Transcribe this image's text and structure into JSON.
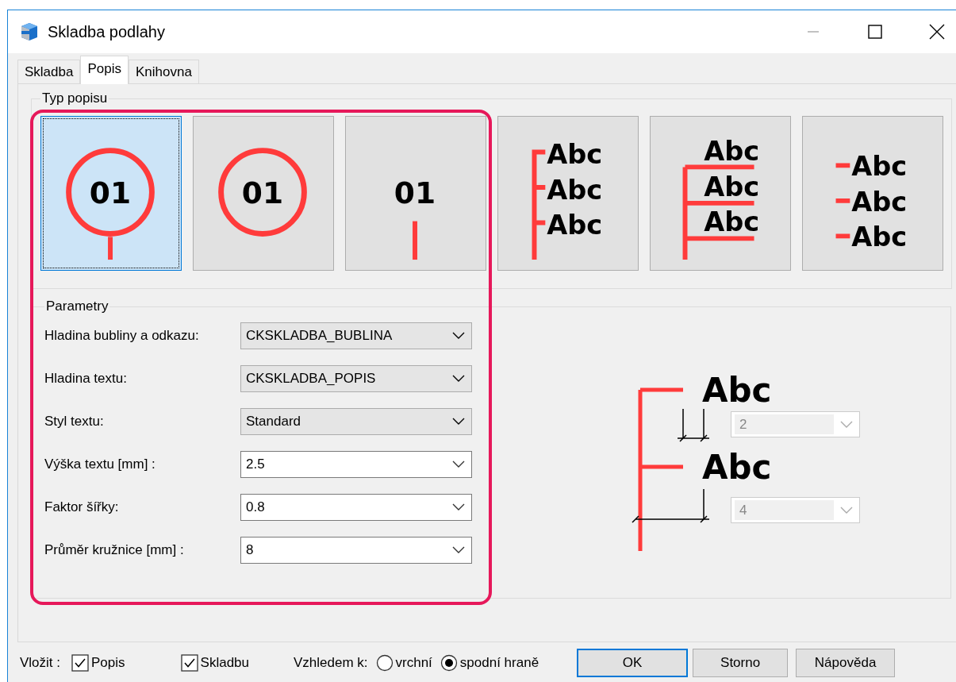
{
  "window": {
    "title": "Skladba podlahy"
  },
  "tabs": [
    {
      "label": "Skladba",
      "selected": false
    },
    {
      "label": "Popis",
      "selected": true
    },
    {
      "label": "Knihovna",
      "selected": false
    }
  ],
  "type_group": {
    "title": "Typ popisu",
    "tiles": [
      {
        "kind": "bubble-stem",
        "labels": [
          "01"
        ],
        "selected": true
      },
      {
        "kind": "bubble",
        "labels": [
          "01"
        ],
        "selected": false
      },
      {
        "kind": "stem",
        "labels": [
          "01"
        ],
        "selected": false
      },
      {
        "kind": "side-ticks",
        "labels": [
          "Abc",
          "Abc",
          "Abc"
        ],
        "selected": false
      },
      {
        "kind": "underlines",
        "labels": [
          "Abc",
          "Abc",
          "Abc"
        ],
        "selected": false
      },
      {
        "kind": "dashes",
        "labels": [
          "Abc",
          "Abc",
          "Abc"
        ],
        "selected": false
      }
    ]
  },
  "parameters": {
    "title": "Parametry",
    "fields": [
      {
        "label": "Hladina bubliny a odkazu:",
        "value": "CKSKLADBA_BUBLINA",
        "kind": "dropdown"
      },
      {
        "label": "Hladina textu:",
        "value": "CKSKLADBA_POPIS",
        "kind": "dropdown"
      },
      {
        "label": "Styl textu:",
        "value": "Standard",
        "kind": "dropdown"
      },
      {
        "label": "Výška textu [mm] :",
        "value": "2.5",
        "kind": "combo"
      },
      {
        "label": "Faktor šířky:",
        "value": "0.8",
        "kind": "combo"
      },
      {
        "label": "Průměr kružnice [mm] :",
        "value": "8",
        "kind": "combo"
      }
    ],
    "diagram": {
      "labels": [
        "Abc",
        "Abc"
      ],
      "fields": [
        {
          "value": "2",
          "disabled": true
        },
        {
          "value": "4",
          "disabled": true
        }
      ]
    }
  },
  "insert": {
    "label": "Vložit :",
    "options": [
      {
        "label": "Popis",
        "checked": true
      },
      {
        "label": "Skladbu",
        "checked": true
      }
    ]
  },
  "relative_to": {
    "label": "Vzhledem k:",
    "options": [
      {
        "label": "vrchní",
        "selected": false
      },
      {
        "label": "spodní hraně",
        "selected": true
      }
    ]
  },
  "buttons": [
    {
      "label": "OK",
      "default": true
    },
    {
      "label": "Storno",
      "default": false
    },
    {
      "label": "Nápověda",
      "default": false
    }
  ]
}
